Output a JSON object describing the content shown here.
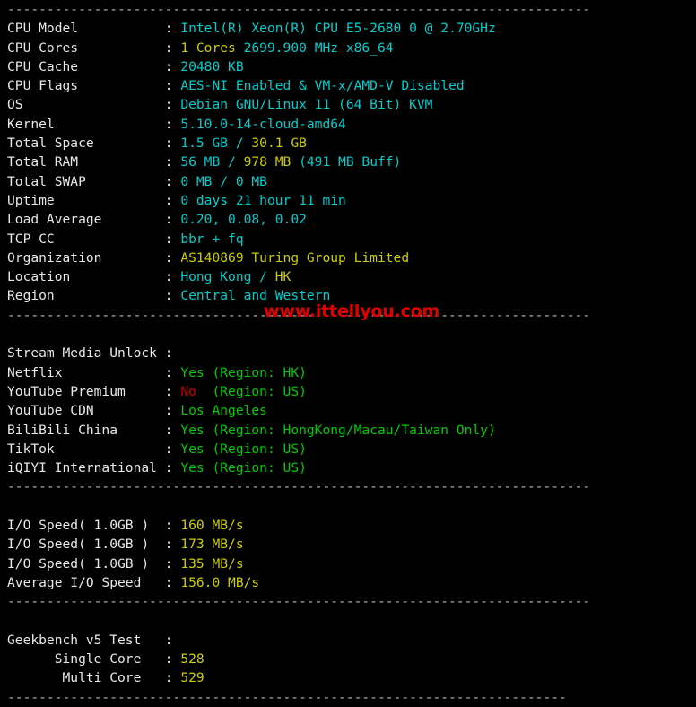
{
  "terminal": {
    "separator": "--------------------------------------------------------------------------",
    "separator_short": "-----------------------------------------------------------------------",
    "watermark": "www.ittellyou.com",
    "colon": ":",
    "colors": {
      "background": "#000000",
      "label": "#e8e8e8",
      "cyan": "#00cdcd",
      "yellow": "#cdcd00",
      "green": "#00cc00",
      "red": "#cc0000",
      "separator": "#b8b8b8",
      "watermark": "#e00000"
    },
    "system_info": [
      {
        "label": "CPU Model",
        "parts": [
          {
            "text": "Intel(R) Xeon(R) CPU E5-2680 0 @ 2.70GHz",
            "color": "cyan"
          }
        ]
      },
      {
        "label": "CPU Cores",
        "parts": [
          {
            "text": "1 Cores",
            "color": "yellow"
          },
          {
            "text": " 2699.900 MHz x86_64",
            "color": "cyan"
          }
        ]
      },
      {
        "label": "CPU Cache",
        "parts": [
          {
            "text": "20480 KB",
            "color": "cyan"
          }
        ]
      },
      {
        "label": "CPU Flags",
        "parts": [
          {
            "text": "AES-NI Enabled & VM-x/AMD-V Disabled",
            "color": "cyan"
          }
        ]
      },
      {
        "label": "OS",
        "parts": [
          {
            "text": "Debian GNU/Linux 11 (64 Bit) KVM",
            "color": "cyan"
          }
        ]
      },
      {
        "label": "Kernel",
        "parts": [
          {
            "text": "5.10.0-14-cloud-amd64",
            "color": "cyan"
          }
        ]
      },
      {
        "label": "Total Space",
        "parts": [
          {
            "text": "1.5 GB / ",
            "color": "cyan"
          },
          {
            "text": "30.1 GB",
            "color": "yellow"
          }
        ]
      },
      {
        "label": "Total RAM",
        "parts": [
          {
            "text": "56 MB / ",
            "color": "cyan"
          },
          {
            "text": "978 MB",
            "color": "yellow"
          },
          {
            "text": " (491 MB Buff)",
            "color": "cyan"
          }
        ]
      },
      {
        "label": "Total SWAP",
        "parts": [
          {
            "text": "0 MB / 0 MB",
            "color": "cyan"
          }
        ]
      },
      {
        "label": "Uptime",
        "parts": [
          {
            "text": "0 days 21 hour 11 min",
            "color": "cyan"
          }
        ]
      },
      {
        "label": "Load Average",
        "parts": [
          {
            "text": "0.20, 0.08, 0.02",
            "color": "cyan"
          }
        ]
      },
      {
        "label": "TCP CC",
        "parts": [
          {
            "text": "bbr + fq",
            "color": "cyan"
          }
        ]
      },
      {
        "label": "Organization",
        "parts": [
          {
            "text": "AS140869 Turing Group Limited",
            "color": "yellow"
          }
        ]
      },
      {
        "label": "Location",
        "parts": [
          {
            "text": "Hong Kong / ",
            "color": "cyan"
          },
          {
            "text": "HK",
            "color": "yellow"
          }
        ]
      },
      {
        "label": "Region",
        "parts": [
          {
            "text": "Central and Western",
            "color": "cyan"
          }
        ]
      }
    ],
    "stream_media": [
      {
        "label": "Stream Media Unlock",
        "parts": []
      },
      {
        "label": "Netflix",
        "parts": [
          {
            "text": "Yes (Region: HK)",
            "color": "green"
          }
        ]
      },
      {
        "label": "YouTube Premium",
        "parts": [
          {
            "text": "No",
            "color": "red"
          },
          {
            "text": "  (Region: US)",
            "color": "green"
          }
        ]
      },
      {
        "label": "YouTube CDN",
        "parts": [
          {
            "text": "Los Angeles",
            "color": "green"
          }
        ]
      },
      {
        "label": "BiliBili China",
        "parts": [
          {
            "text": "Yes (Region: HongKong/Macau/Taiwan Only)",
            "color": "green"
          }
        ]
      },
      {
        "label": "TikTok",
        "parts": [
          {
            "text": "Yes (Region: US)",
            "color": "green"
          }
        ]
      },
      {
        "label": "iQIYI International",
        "parts": [
          {
            "text": "Yes (Region: US)",
            "color": "green"
          }
        ]
      }
    ],
    "io_speed": [
      {
        "label": "I/O Speed( 1.0GB )",
        "parts": [
          {
            "text": "160 MB/s",
            "color": "yellow"
          }
        ]
      },
      {
        "label": "I/O Speed( 1.0GB )",
        "parts": [
          {
            "text": "173 MB/s",
            "color": "yellow"
          }
        ]
      },
      {
        "label": "I/O Speed( 1.0GB )",
        "parts": [
          {
            "text": "135 MB/s",
            "color": "yellow"
          }
        ]
      },
      {
        "label": "Average I/O Speed",
        "parts": [
          {
            "text": "156.0 MB/s",
            "color": "yellow"
          }
        ]
      }
    ],
    "geekbench": [
      {
        "label": "Geekbench v5 Test",
        "parts": []
      },
      {
        "label": "      Single Core",
        "parts": [
          {
            "text": "528",
            "color": "yellow"
          }
        ]
      },
      {
        "label": "       Multi Core",
        "parts": [
          {
            "text": "529",
            "color": "yellow"
          }
        ]
      }
    ]
  }
}
